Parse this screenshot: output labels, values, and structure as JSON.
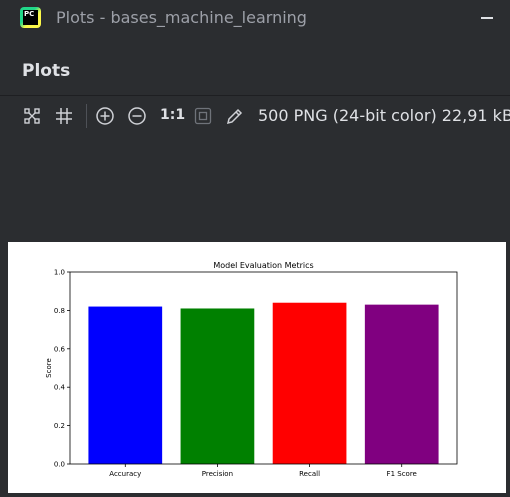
{
  "window": {
    "title": "Plots - bases_machine_learning",
    "logo_text": "PC"
  },
  "panel": {
    "title": "Plots"
  },
  "toolbar": {
    "zoom_actual_label": "1:1",
    "image_info": "500 PNG (24-bit color) 22,91 kB"
  },
  "icons": [
    "fit-content-icon",
    "grid-icon",
    "zoom-in-icon",
    "zoom-out-icon",
    "actual-size-icon",
    "fit-zoom-icon",
    "color-picker-icon",
    "minimize-icon"
  ],
  "colors": {
    "background": "#2b2d30",
    "text": "#dfe1e5",
    "title_text": "#9da0a8"
  },
  "chart_data": {
    "type": "bar",
    "title": "Model Evaluation Metrics",
    "xlabel": "",
    "ylabel": "Score",
    "categories": [
      "Accuracy",
      "Precision",
      "Recall",
      "F1 Score"
    ],
    "values": [
      0.82,
      0.81,
      0.84,
      0.83
    ],
    "colors": [
      "#0000ff",
      "#008000",
      "#ff0000",
      "#800080"
    ],
    "ylim": [
      0,
      1.0
    ],
    "yticks": [
      "0.0",
      "0.2",
      "0.4",
      "0.6",
      "0.8",
      "1.0"
    ],
    "grid": false,
    "legend": "none"
  }
}
